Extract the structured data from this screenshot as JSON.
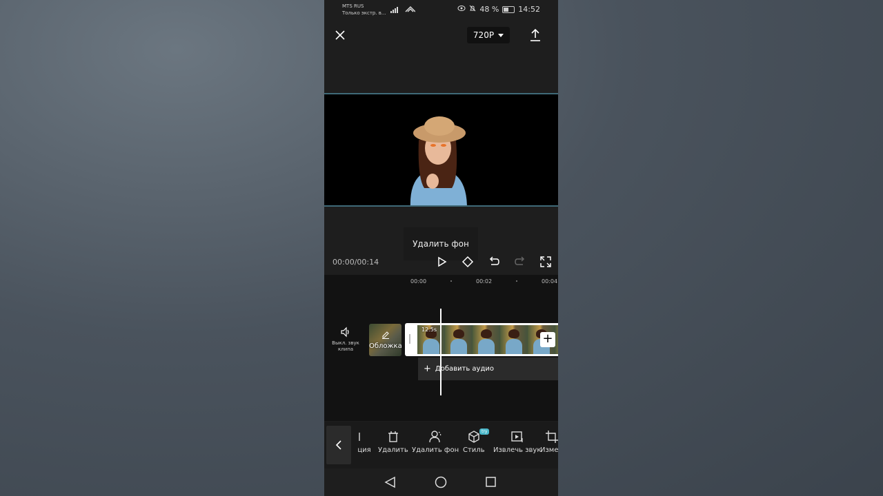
{
  "status": {
    "carrier": "MTS RUS",
    "carrier_sub": "Только экстр. в...",
    "battery": "48 %",
    "time": "14:52"
  },
  "topbar": {
    "resolution": "720P"
  },
  "tooltip": "Удалить фон",
  "player": {
    "timecode": "00:00/00:14"
  },
  "ruler": [
    "00:00",
    "00:02",
    "00:04"
  ],
  "timeline": {
    "mute_label": "Выкл. звук клипа",
    "cover_label": "Обложка",
    "clip_duration": "12.5s",
    "add_audio": "Добавить аудио"
  },
  "toolbar": {
    "items": [
      {
        "label": "ция",
        "icon": "partial-icon"
      },
      {
        "label": "Удалить",
        "icon": "delete-icon"
      },
      {
        "label": "Удалить фон",
        "icon": "remove-bg-icon"
      },
      {
        "label": "Стиль",
        "icon": "style-cube-icon"
      },
      {
        "label": "Извлечь звук",
        "icon": "extract-audio-icon"
      },
      {
        "label": "Измен",
        "icon": "crop-icon"
      }
    ],
    "try_badge": "try"
  },
  "colors": {
    "accent": "#4bb7c9",
    "preview_border": "#3f6a78",
    "background": "#1e1e1e"
  }
}
